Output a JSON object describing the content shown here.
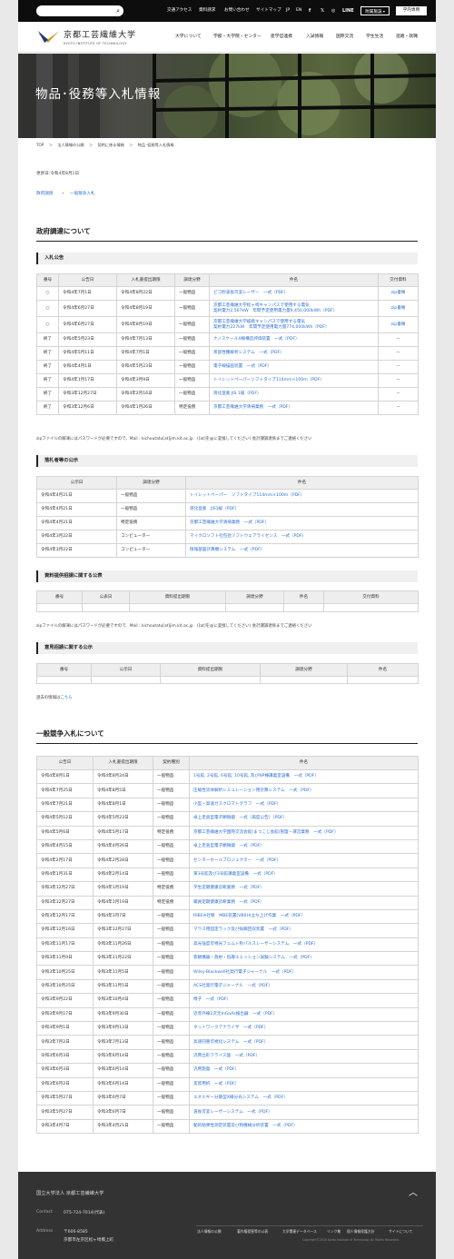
{
  "topbar": {
    "search_placeholder": "",
    "links": [
      "交通アクセス",
      "資料請求",
      "お問い合わせ",
      "サイトマップ",
      "JP",
      "EN"
    ],
    "social": [
      "f",
      "𝕏",
      "◎",
      "LINE"
    ],
    "btn_lab": "附属施設",
    "btn_site": "学内専用"
  },
  "header": {
    "logo_ja": "京都工芸繊維大学",
    "logo_en": "KYOTO INSTITUTE OF TECHNOLOGY",
    "nav": [
      "大学について",
      "学部・大学院・センター",
      "産学官連携",
      "入試情報",
      "国際交流",
      "学生生活",
      "進路・就職"
    ]
  },
  "hero": {
    "title": "物品･役務等入札情報"
  },
  "breadcrumb": [
    "TOP",
    "＞",
    "法人情報の公開",
    "＞",
    "契約に係る情報",
    "＞",
    "物品･役務等入札情報"
  ],
  "updated": "更新日:令和4年8月1日",
  "anchors": [
    "政府調達",
    "・",
    "一般競争入札"
  ],
  "gov": {
    "title": "政府調達について",
    "bid": {
      "title": "入札公告",
      "headers": [
        "番号",
        "公告日",
        "入札書提出期限",
        "調達分野",
        "件名",
        "交付資料"
      ],
      "rows": [
        [
          "○",
          "令和4年7月1日",
          "令和4年8月22日",
          "一般物品",
          "ピコ秒波長可変レーザー　一式（PDF）",
          "zip書類"
        ],
        [
          "○",
          "令和4年6月27日",
          "令和4年8月19日",
          "一般物品",
          "京都工芸繊維大学松ヶ崎キャンパスで使用する電気\n契約電力2,567kW　年間予定使用電力量9,450,000kWh（PDF）",
          "zip書類"
        ],
        [
          "○",
          "令和4年6月27日",
          "令和4年8月19日",
          "一般物品",
          "京都工芸繊維大学嵯峨キャンパスで使用する電気\n契約電力227kW　年間予定使用電力量774,000kWh（PDF）",
          "zip書類"
        ],
        [
          "終了",
          "令和4年5月23日",
          "令和4年7月13日",
          "一般物品",
          "ナノスケールX線構造評価装置　一式（PDF）",
          "－"
        ],
        [
          "終了",
          "令和4年5月11日",
          "令和4年7月1日",
          "一般物品",
          "蒸留性種解析システム　一式（PDF）",
          "－"
        ],
        [
          "終了",
          "令和4年4月1日",
          "令和4年5月23日",
          "一般物品",
          "電子線描画装置　一式（PDF）",
          "－"
        ],
        [
          "終了",
          "令和4年1月17日",
          "令和4年3月9日",
          "一般物品",
          "トイレットペーパーソフトタイプ114mm×100m（PDF）",
          "－"
        ],
        [
          "終了",
          "令和3年12月27日",
          "令和4年2月16日",
          "一般物品",
          "液化窒素 JIS 1級（PDF）",
          "－"
        ],
        [
          "終了",
          "令和3年12月6日",
          "令和4年1月26日",
          "特定役務",
          "京都工芸繊維大学清掃業務　一式（PDF）",
          "－"
        ]
      ]
    },
    "note1": "zipファイルの解凍にはパスワードが必要ですので、Mail : kichoutatu[at]jim.kit.ac.jp　([at]を@に変換してください) 会計課調達係までご連絡ください",
    "award": {
      "title": "落札者等の公示",
      "headers": [
        "公示日",
        "調達分野",
        "件名"
      ],
      "rows": [
        [
          "令和4年4月21日",
          "一般物品",
          "トイレットペーパー　ソフトタイプ114mm×100m（PDF）"
        ],
        [
          "令和4年4月21日",
          "一般物品",
          "液化窒素　JIS1級（PDF）"
        ],
        [
          "令和4年4月21日",
          "特定役務",
          "京都工芸繊維大学清掃業務　一式（PDF）"
        ],
        [
          "令和4年3月22日",
          "コンピューター",
          "マイクロソフト社包括ソフトウェアライセンス　一式（PDF）"
        ],
        [
          "令和4年3月22日",
          "コンピューター",
          "情報基盤計算機システム　一式（PDF）"
        ]
      ]
    },
    "material": {
      "title": "資料提供招請に関する公表",
      "headers": [
        "番号",
        "公表日",
        "資料提出期限",
        "調達分野",
        "件名",
        "交付資料"
      ]
    },
    "note2": "zipファイルの解凍にはパスワードが必要ですので、Mail : kichoutatu[at]jim.kit.ac.jp　([at]を@に変換してください) 会計課調達係までご連絡ください",
    "opinion": {
      "title": "意見招請に関する公示",
      "headers": [
        "番号",
        "公示日",
        "資料提出期限",
        "調達分野",
        "件名"
      ]
    },
    "past_prefix": "過去の情報は",
    "past_link": "こちら"
  },
  "general": {
    "title": "一般競争入札について",
    "headers": [
      "公告日",
      "入札書提出期限",
      "契約種別",
      "件名"
    ],
    "rows": [
      [
        "令和4年8月1日",
        "令和4年8月24日",
        "一般物品",
        "1号館, 2号館, 6号館, 10号館, 及びNP棟講義室設備　一式（PDF）"
      ],
      [
        "令和4年7月25日",
        "令和4年8月5日",
        "一般物品",
        "圧縮性流体解析シミュレーション用計算システム　一式（PDF）"
      ],
      [
        "令和4年7月21日",
        "令和4年8月1日",
        "一般物品",
        "小型・高速ガスクロマトグラフ　一式（PDF）"
      ],
      [
        "令和4年5月12日",
        "令和4年5月23日",
        "一般物品",
        "卓上走査型電子顕微鏡　一式（再度公告）（PDF）"
      ],
      [
        "令和4年5月6日",
        "令和4年5月17日",
        "特定役務",
        "京都工芸繊維大学国際交流会館(まつこじ会館)管理・運営業務　一式（PDF）"
      ],
      [
        "令和4年4月15日",
        "令和4年4月26日",
        "一般物品",
        "卓上走査型電子顕微鏡　一式（PDF）"
      ],
      [
        "令和4年2月17日",
        "令和4年2月28日",
        "一般物品",
        "センターホールプロジェクター　一式（PDF）"
      ],
      [
        "令和4年1月31日",
        "令和4年2月14日",
        "一般物品",
        "東3号館及び3号館講義室設備　一式（PDF）"
      ],
      [
        "令和3年12月27日",
        "令和4年1月19日",
        "特定役務",
        "学生定期健康診断業務　一式（PDF）"
      ],
      [
        "令和3年12月27日",
        "令和4年1月19日",
        "特定役務",
        "職員定期健康診断業務　一式（PDF）"
      ],
      [
        "令和3年12月17日",
        "令和4年1月7日",
        "一般物品",
        "RIBE※社製　MBE装置(VB0H)立ち上げ作業　一式（PDF）"
      ],
      [
        "令和3年12月16日",
        "令和3年12月27日",
        "一般物品",
        "マウス用固定ラック及び採餌回収装置　一式（PDF）"
      ],
      [
        "令和3年11月17日",
        "令和3年11月26日",
        "一般物品",
        "高光強度可視光フェムト秒パルスレーザーシステム　一式（PDF）"
      ],
      [
        "令和3年11月9日",
        "令和3年11月22日",
        "一般物品",
        "客観機器・放射・低摩エミッション試験システム　一式（PDF）"
      ],
      [
        "令和3年10月25日",
        "令和3年11月5日",
        "一般物品",
        "Wiley-Blackwell社発行電子ジャーナル　一式（PDF）"
      ],
      [
        "令和3年10月25日",
        "令和3年11月5日",
        "一般物品",
        "ACS社発行電子ジャーナル　一式（PDF）"
      ],
      [
        "令和3年9月22日",
        "令和3年10月4日",
        "一般物品",
        "椅子　一式（PDF）"
      ],
      [
        "令和3年9月17日",
        "令和3年9月30日",
        "一般物品",
        "近赤外線2次元InGaAs検出器　一式（PDF）"
      ],
      [
        "令和3年9月1日",
        "令和3年9月13日",
        "一般物品",
        "ネットワークアナライザ　一式（PDF）"
      ],
      [
        "令和3年7月2日",
        "令和3年7月13日",
        "一般物品",
        "高速同重可視化システム　一式（PDF）"
      ],
      [
        "令和3年6月3日",
        "令和3年6月14日",
        "一般物品",
        "汎用立形フライス盤　一式（PDF）"
      ],
      [
        "令和3年6月3日",
        "令和3年6月14日",
        "一般物品",
        "汎用旋盤　一式（PDF）"
      ],
      [
        "令和3年6月2日",
        "令和3年6月14日",
        "一般物品",
        "実習用机　一式（PDF）"
      ],
      [
        "令和3年5月27日",
        "令和3年6月7日",
        "一般物品",
        "エネルギー分散型X線分光システム　一式（PDF）"
      ],
      [
        "令和3年5月27日",
        "令和3年6月7日",
        "一般物品",
        "波長可変レーザーシステム　一式（PDF）"
      ],
      [
        "令和3年4月7日",
        "令和3年4月21日",
        "一般物品",
        "動的粘弾性測定装置及び熱機械分析装置　一式（PDF）"
      ]
    ]
  },
  "footer": {
    "org": "国立大学法人 京都工芸繊維大学",
    "contact_label": "Contact",
    "tel": "075-724-7014(代表)",
    "address_label": "Address",
    "zip": "〒606-8585",
    "address": "京都市左京区松ヶ崎橋上町",
    "links": [
      "法人情報の公開",
      "著作権侵害等の公表",
      "大学関連データベース",
      "リンク集",
      "個人情報保護方針",
      "サイトについて"
    ],
    "copyright": "Copyright©2016 Kyoto Institute of Technology All Rights Reserved."
  },
  "colors": {
    "accent": "#2a6fd6",
    "footer": "#333333",
    "topbar": "#0d0d0d"
  }
}
